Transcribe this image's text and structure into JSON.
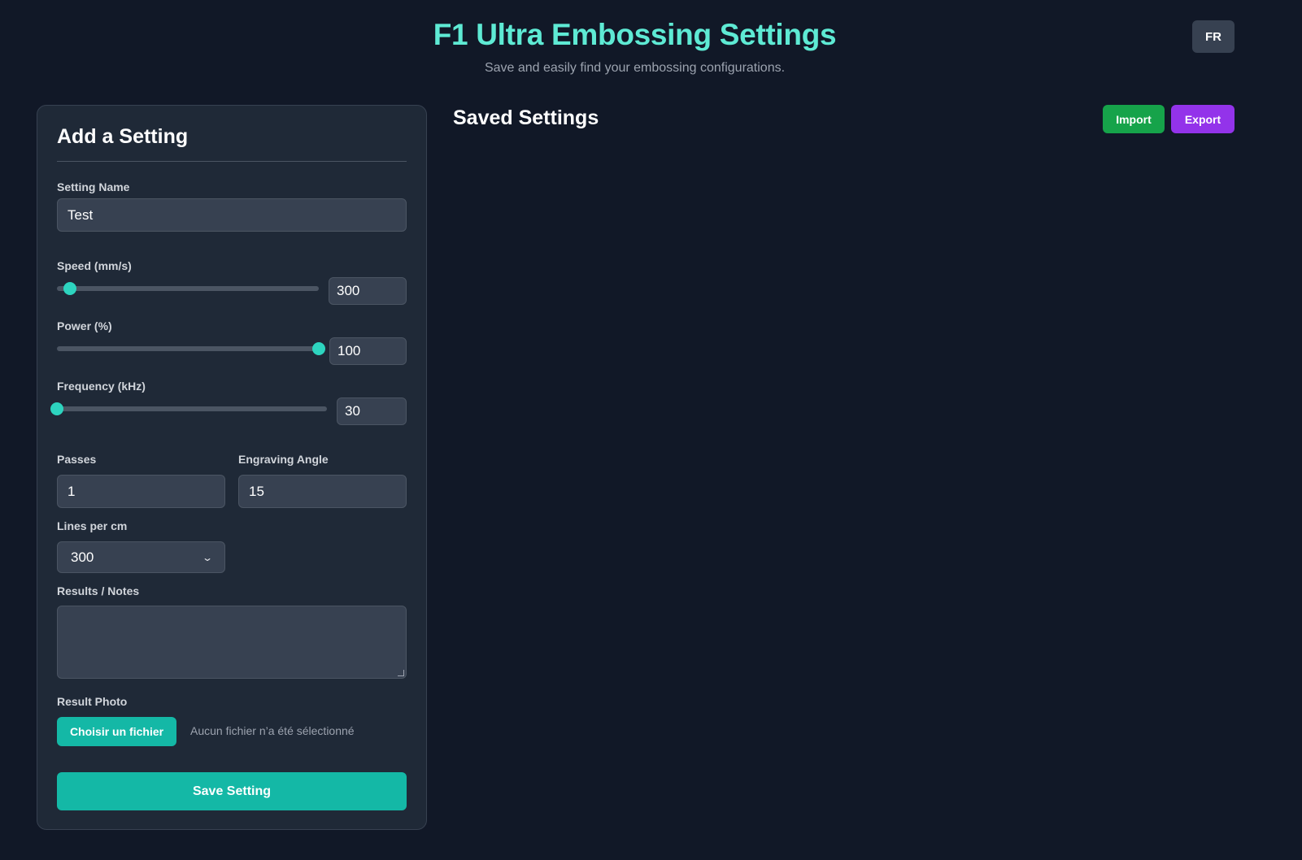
{
  "header": {
    "title": "F1 Ultra Embossing Settings",
    "subtitle": "Save and easily find your embossing configurations.",
    "language_button": "FR"
  },
  "form": {
    "title": "Add a Setting",
    "name": {
      "label": "Setting Name",
      "value": "Test"
    },
    "speed": {
      "label": "Speed (mm/s)",
      "value": "300",
      "slider_fraction": 0.05
    },
    "power": {
      "label": "Power (%)",
      "value": "100",
      "slider_fraction": 1.0
    },
    "frequency": {
      "label": "Frequency (kHz)",
      "value": "30",
      "slider_fraction": 0.0
    },
    "passes": {
      "label": "Passes",
      "value": "1"
    },
    "angle": {
      "label": "Engraving Angle",
      "value": "15"
    },
    "lines_per_cm": {
      "label": "Lines per cm",
      "selected": "300"
    },
    "notes": {
      "label": "Results / Notes",
      "value": ""
    },
    "photo": {
      "label": "Result Photo",
      "button": "Choisir un fichier",
      "status": "Aucun fichier n’a été sélectionné"
    },
    "save_button": "Save Setting"
  },
  "saved": {
    "title": "Saved Settings",
    "import_button": "Import",
    "export_button": "Export"
  },
  "colors": {
    "accent": "#5eead4",
    "primary_button": "#14b8a6",
    "import_button": "#16a34a",
    "export_button": "#9333ea",
    "background": "#111827",
    "panel": "#1f2937"
  },
  "icons": {
    "select_arrow": "chevron-down-icon"
  }
}
